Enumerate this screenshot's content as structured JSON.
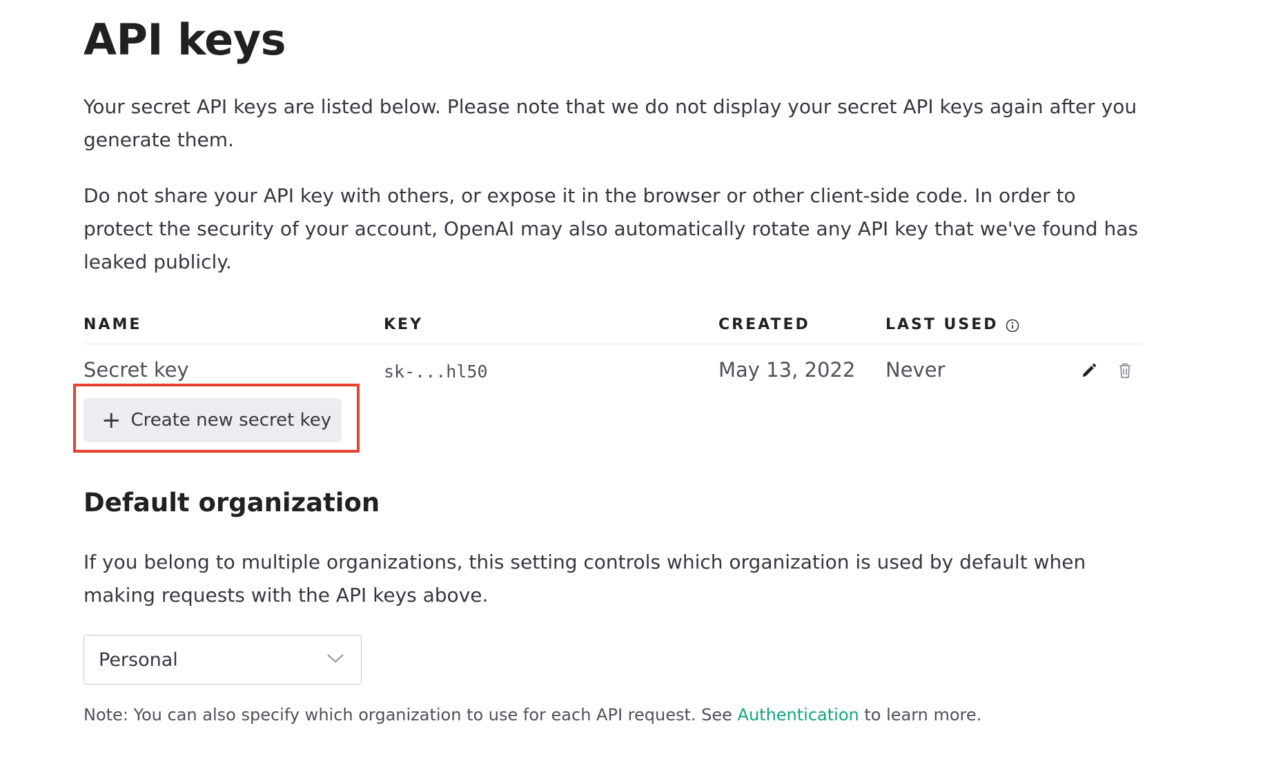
{
  "page": {
    "title": "API keys",
    "intro": "Your secret API keys are listed below. Please note that we do not display your secret API keys again after you generate them.",
    "warning": "Do not share your API key with others, or expose it in the browser or other client-side code. In order to protect the security of your account, OpenAI may also automatically rotate any API key that we've found has leaked publicly."
  },
  "keys_table": {
    "columns": {
      "name": "NAME",
      "key": "KEY",
      "created": "CREATED",
      "last_used": "LAST USED"
    },
    "rows": [
      {
        "name": "Secret key",
        "key": "sk-...hl50",
        "created": "May 13, 2022",
        "last_used": "Never"
      }
    ],
    "icons": {
      "info": "info-icon",
      "edit": "pencil-icon",
      "delete": "trash-icon"
    }
  },
  "create_button": {
    "icon": "+",
    "label": "Create new secret key",
    "highlight_color": "#e6412f"
  },
  "default_org": {
    "title": "Default organization",
    "description": "If you belong to multiple organizations, this setting controls which organization is used by default when making requests with the API keys above.",
    "select_value": "Personal",
    "note_before": "Note: You can also specify which organization to use for each API request. See ",
    "note_link": "Authentication",
    "note_after": " to learn more."
  },
  "colors": {
    "link": "#10a37f",
    "button_bg": "#ececf1",
    "text": "#353740",
    "heading": "#202123"
  }
}
